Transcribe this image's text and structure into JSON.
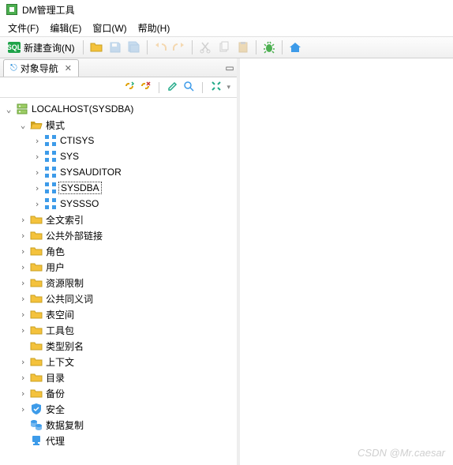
{
  "app": {
    "title": "DM管理工具"
  },
  "menu": {
    "file": "文件(F)",
    "edit": "编辑(E)",
    "window": "窗口(W)",
    "help": "帮助(H)"
  },
  "toolbar": {
    "new_query": "新建查询(N)"
  },
  "panel": {
    "title": "对象导航"
  },
  "tree": {
    "root": "LOCALHOST(SYSDBA)",
    "schema": "模式",
    "schemas": [
      "CTISYS",
      "SYS",
      "SYSAUDITOR",
      "SYSDBA",
      "SYSSSO"
    ],
    "selected_schema": "SYSDBA",
    "folders": [
      "全文索引",
      "公共外部链接",
      "角色",
      "用户",
      "资源限制",
      "公共同义词",
      "表空间",
      "工具包",
      "类型别名",
      "上下文",
      "目录",
      "备份"
    ],
    "security": "安全",
    "replication": "数据复制",
    "agent": "代理"
  },
  "watermark": "CSDN @Mr.caesar"
}
